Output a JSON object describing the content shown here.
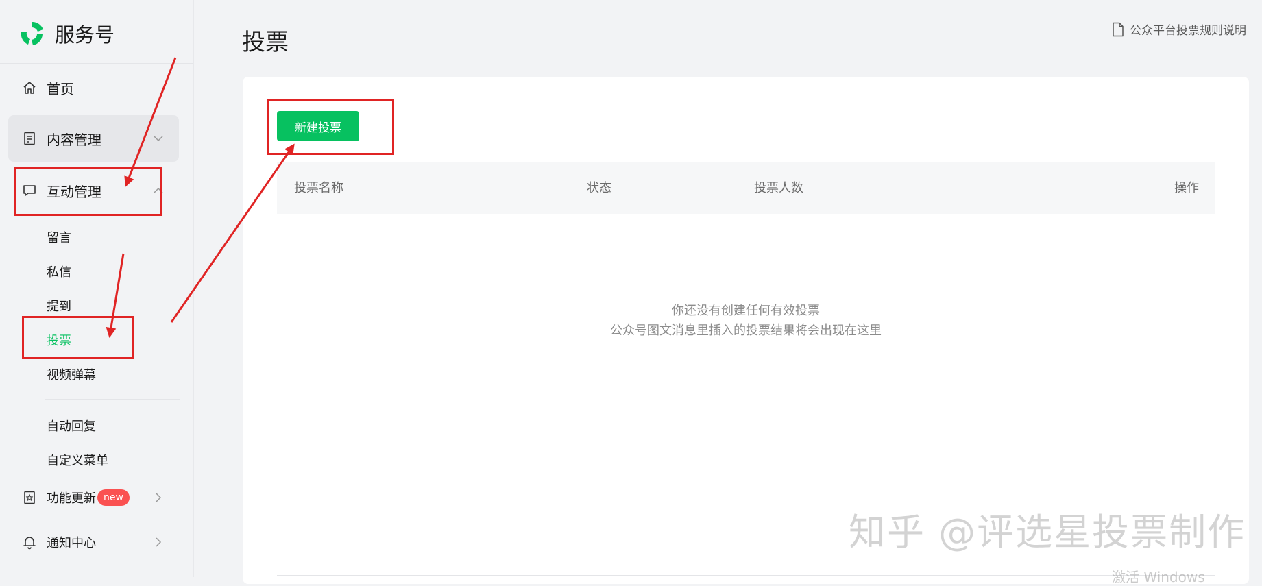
{
  "sidebar": {
    "brand_name": "服务号",
    "items": [
      {
        "label": "首页",
        "icon": "home-icon"
      },
      {
        "label": "内容管理",
        "icon": "document-icon"
      },
      {
        "label": "互动管理",
        "icon": "chat-icon"
      }
    ],
    "sub_items": [
      "留言",
      "私信",
      "提到",
      "投票",
      "视频弹幕",
      "自动回复",
      "自定义菜单"
    ],
    "bottom_items": [
      {
        "label": "功能更新",
        "badge": "new",
        "icon": "feature-update-icon"
      },
      {
        "label": "通知中心",
        "icon": "bell-icon"
      }
    ],
    "active_sub": "投票"
  },
  "header": {
    "title": "投票",
    "rules_link": "公众平台投票规则说明"
  },
  "main": {
    "new_button": "新建投票",
    "table_headers": [
      "投票名称",
      "状态",
      "投票人数",
      "操作"
    ],
    "empty_line1": "你还没有创建任何有效投票",
    "empty_line2": "公众号图文消息里插入的投票结果将会出现在这里"
  },
  "watermark": {
    "text": "知乎 @评选星投票制作",
    "os_text": "激活 Windows"
  },
  "colors": {
    "accent": "#07c160",
    "badge": "#fa5151",
    "annotation": "#e02424"
  }
}
